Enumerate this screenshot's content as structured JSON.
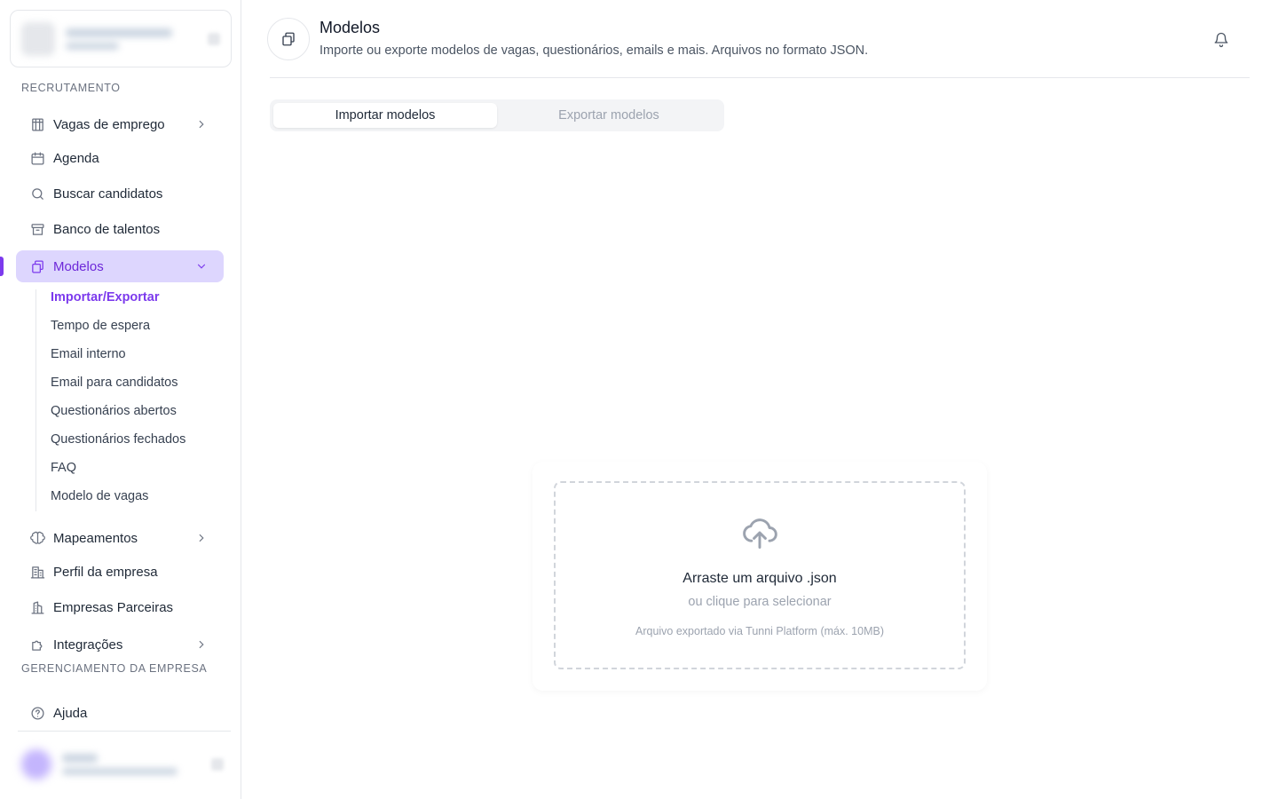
{
  "sidebar": {
    "section_recruitment": "RECRUTAMENTO",
    "section_management": "GERENCIAMENTO DA EMPRESA",
    "items": {
      "vagas": "Vagas de emprego",
      "agenda": "Agenda",
      "buscar": "Buscar candidatos",
      "banco": "Banco de talentos",
      "modelos": "Modelos",
      "mapeamentos": "Mapeamentos",
      "perfil": "Perfil da empresa",
      "parceiras": "Empresas Parceiras",
      "integracoes": "Integrações",
      "ajuda": "Ajuda"
    },
    "submenu": {
      "importar": "Importar/Exportar",
      "tempo": "Tempo de espera",
      "email_interno": "Email interno",
      "email_candidatos": "Email para candidatos",
      "q_abertos": "Questionários abertos",
      "q_fechados": "Questionários fechados",
      "faq": "FAQ",
      "modelo_vagas": "Modelo de vagas"
    }
  },
  "header": {
    "title": "Modelos",
    "subtitle": "Importe ou exporte modelos de vagas, questionários, emails e mais. Arquivos no formato JSON."
  },
  "tabs": {
    "import": "Importar modelos",
    "export": "Exportar modelos"
  },
  "dropzone": {
    "title": "Arraste um arquivo .json",
    "subtitle": "ou clique para selecionar",
    "hint": "Arquivo exportado via Tunni Platform (máx. 10MB)"
  },
  "colors": {
    "accent": "#7c3aed",
    "accent_bg": "#ddd6fe"
  }
}
